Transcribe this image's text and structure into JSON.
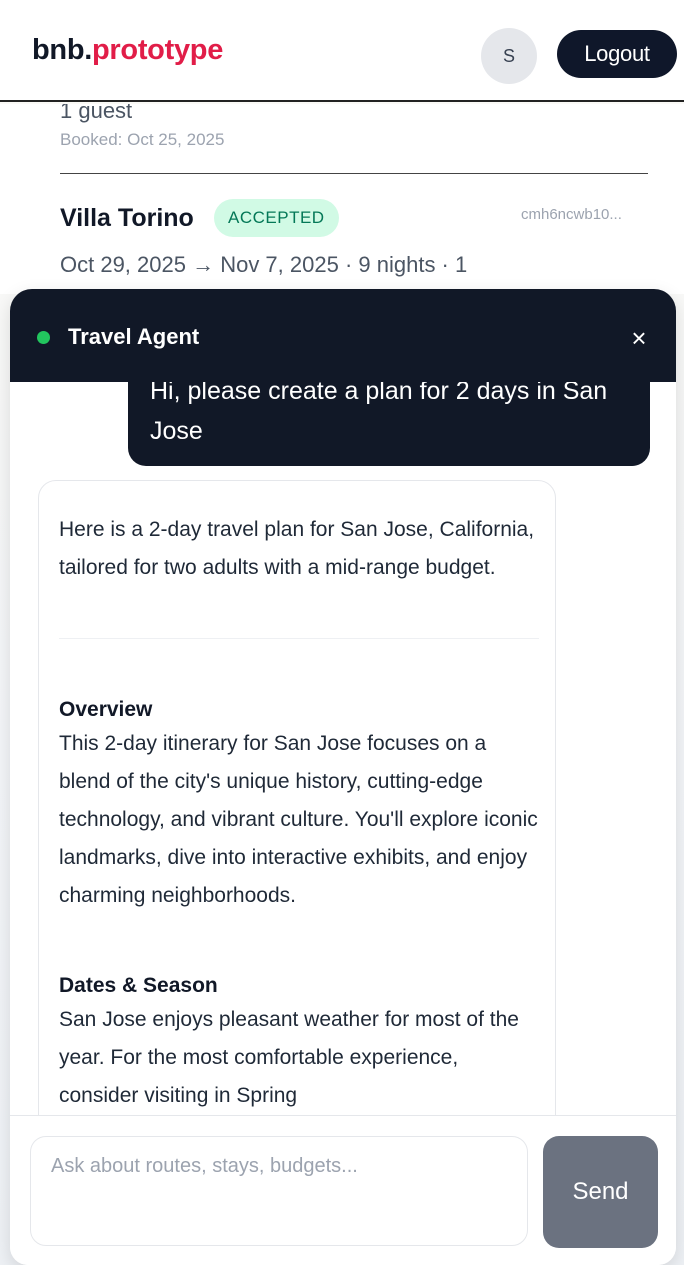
{
  "header": {
    "brand_part1": "bnb.",
    "brand_part2": "prototype",
    "avatar_initial": "S",
    "logout_label": "Logout"
  },
  "bookings": {
    "prev_guests": "1 guest",
    "prev_booked": "Booked: Oct 25, 2025",
    "current": {
      "title": "Villa Torino",
      "status": "ACCEPTED",
      "id": "cmh6ncwb10...",
      "dates": "Oct 29, 2025 → Nov 7, 2025 · 9 nights · 1"
    }
  },
  "chat": {
    "agent_name": "Travel Agent",
    "close_label": "×",
    "user_message": "Hi, please create a plan for 2 days in San Jose",
    "ai_intro": "Here is a 2-day travel plan for San Jose, California, tailored for two adults with a mid-range budget.",
    "sections": [
      {
        "heading": "Overview",
        "text": "This 2-day itinerary for San Jose focuses on a blend of the city's unique history, cutting-edge technology, and vibrant culture. You'll explore iconic landmarks, dive into interactive exhibits, and enjoy charming neighborhoods."
      },
      {
        "heading": "Dates & Season",
        "text": "San Jose enjoys pleasant weather for most of the year. For the most comfortable experience, consider visiting in Spring"
      }
    ],
    "input_placeholder": "Ask about routes, stays, budgets...",
    "send_label": "Send"
  },
  "colors": {
    "brand_accent": "#e11d48",
    "dark": "#111827",
    "online": "#22c55e",
    "accepted_bg": "#d1fae5",
    "accepted_text": "#047857",
    "send_bg": "#6b7280"
  }
}
